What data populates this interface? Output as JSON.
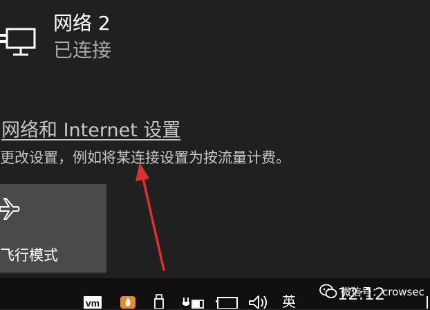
{
  "network": {
    "icon": "ethernet-computer-icon",
    "name": "网络 2",
    "status": "已连接"
  },
  "settings": {
    "link_text": "网络和 Internet 设置",
    "description": "更改设置，例如将某连接设置为按流量计费。"
  },
  "quick_action": {
    "icon": "airplane-icon",
    "label": "飞行模式"
  },
  "annotation": {
    "color": "#e02f2f"
  },
  "taskbar": {
    "tray_icons": [
      "vmware-icon",
      "flame-app-icon",
      "usb-drive-icon",
      "power-plug-icon",
      "network-icon",
      "volume-icon"
    ],
    "input_method": "英",
    "clock": "12:12"
  },
  "watermark": {
    "icon": "wechat-icon",
    "text": "微信号：crowsec"
  },
  "colors": {
    "background": "#202020",
    "tile": "#4a4a4a",
    "taskbar": "#101010",
    "secondary_text": "#a6a6a6"
  }
}
